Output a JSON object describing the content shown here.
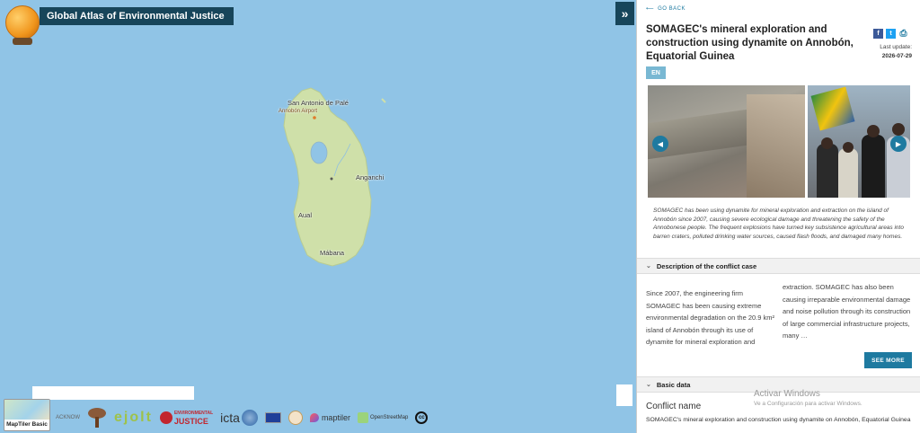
{
  "map": {
    "brand_title": "Global Atlas of Environmental Justice",
    "expand_icon": "double-chevron-right-icon",
    "labels": {
      "san_antonio": "San Antonio de Palé",
      "airport": "Annobón Airport",
      "anganchi": "Anganchi",
      "aual": "Aual",
      "mabana": "Mábana"
    },
    "basemap_label": "MapTiler Basic",
    "logos": {
      "acknowledgements": "ACKNOW",
      "ejolt": "ejolt",
      "envj_top": "ENVIRONMENTAL",
      "envj_bottom": "JUSTICE",
      "icta": "icta",
      "maptiler": "maptiler",
      "osm": "OpenStreetMap",
      "cc": "cc"
    },
    "colors": {
      "sea": "#90c4e6",
      "land": "#cfe0a9",
      "brand": "#17455a"
    }
  },
  "panel": {
    "go_back": "GO BACK",
    "title": "SOMAGEC's mineral exploration and construction using dynamite on Annobón, Equatorial Guinea",
    "last_update_label": "Last update:",
    "last_update_date": "2026-07-29",
    "share": {
      "facebook": "f",
      "twitter": "t",
      "print": "⎙"
    },
    "language_badge": "EN",
    "caption": "SOMAGEC has been using dynamite for mineral exploration and extraction on the island of Annobón since 2007, causing severe ecological damage and threatening the safety of the Annobonese people. The frequent explosions have turned key subsistence agricultural areas into barren craters, polluted drinking water sources, caused flash floods, and damaged many homes.",
    "description_heading": "Description of the conflict case",
    "description_col1": "Since 2007, the engineering firm SOMAGEC has been causing extreme environmental degradation on the 20.9 km² island of Annobón through its use of dynamite for mineral exploration and",
    "description_col2": "extraction. SOMAGEC has also been causing irreparable environmental damage and noise pollution through its construction of large commercial infrastructure projects, many …",
    "see_more": "SEE MORE",
    "basic_data_heading": "Basic data",
    "conflict_name_label": "Conflict name",
    "conflict_name_value": "SOMAGEC's mineral exploration and construction using dynamite on Annobón, Equatorial Guinea",
    "accent": "#1e7aa0"
  },
  "watermark": {
    "line1": "Activar Windows",
    "line2": "Ve a Configuración para activar Windows."
  }
}
